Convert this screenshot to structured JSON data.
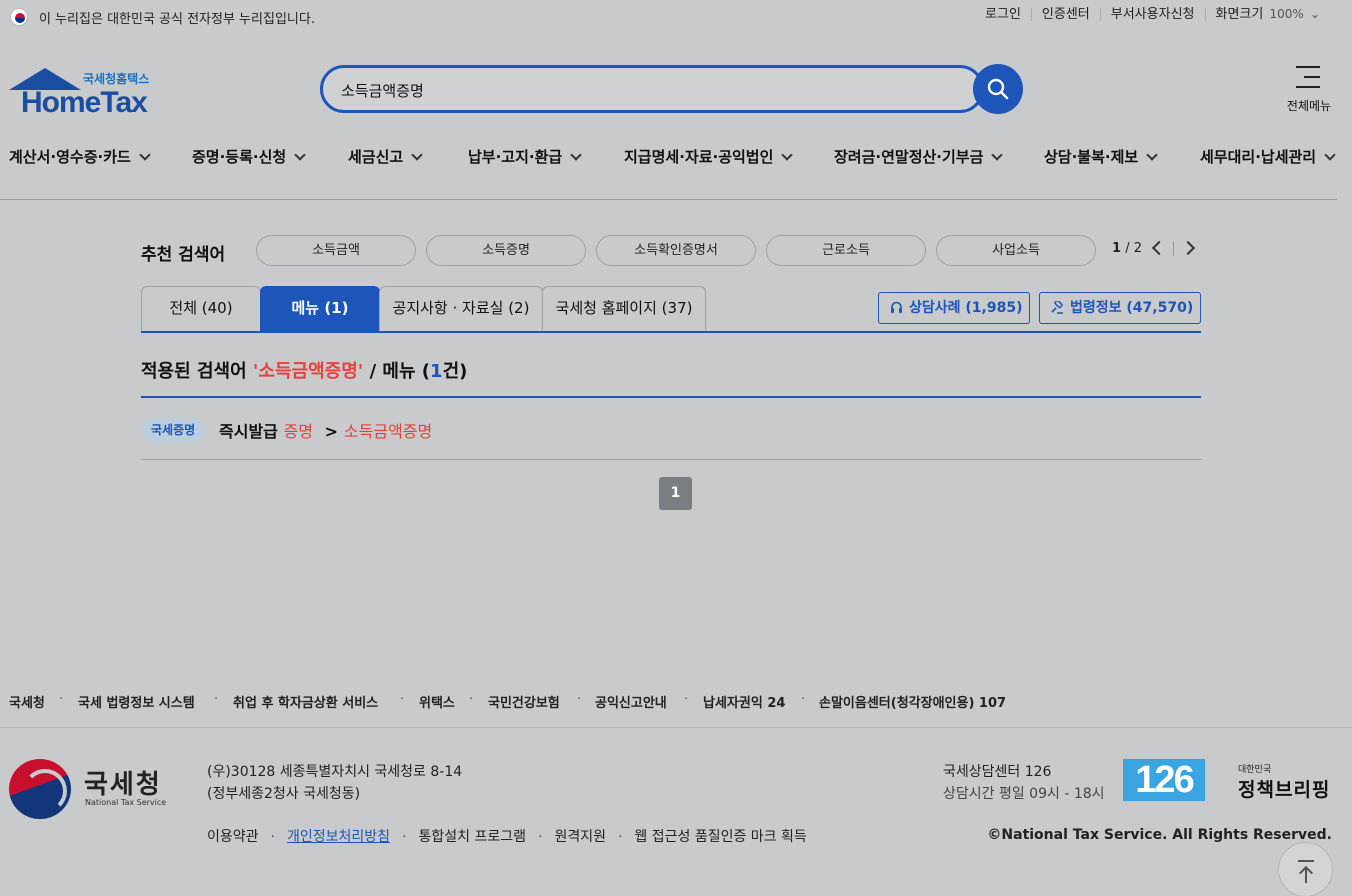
{
  "gov_banner": {
    "text": "이 누리집은 대한민국 공식 전자정부 누리집입니다."
  },
  "utility": {
    "login": "로그인",
    "cert": "인증센터",
    "dept": "부서사용자신청",
    "screen": "화면크기",
    "zoom": "100%"
  },
  "logo": {
    "small": "국세청홈택스",
    "big": "HomeTax"
  },
  "search": {
    "value": "소득금액증명"
  },
  "allmenu": {
    "label": "전체메뉴"
  },
  "gnb": [
    "계산서·영수증·카드",
    "증명·등록·신청",
    "세금신고",
    "납부·고지·환급",
    "지급명세·자료·공익법인",
    "장려금·연말정산·기부금",
    "상담·불복·제보",
    "세무대리·납세관리"
  ],
  "recommend": {
    "title": "추천 검색어",
    "chips": [
      "소득금액",
      "소득증명",
      "소득확인증명서",
      "근로소득",
      "사업소득"
    ],
    "page_current": "1",
    "page_total": "/ 2"
  },
  "tabs": [
    {
      "label": "전체 (40)"
    },
    {
      "label": "메뉴 (1)"
    },
    {
      "label": "공지사항 · 자료실 (2)"
    },
    {
      "label": "국세청 홈페이지 (37)"
    }
  ],
  "side_buttons": {
    "consult": "상담사례 (1,985)",
    "law": "법령정보 (47,570)"
  },
  "applied": {
    "prefix": "적용된 검색어 ",
    "query": "'소득금액증명'",
    "mid": " / 메뉴 (",
    "count": "1",
    "suffix": "건)"
  },
  "result": {
    "badge": "국세증명",
    "crumb1": "즉시발급",
    "crumb2": "증명",
    "sep": ">",
    "crumb3": "소득금액증명"
  },
  "pagination": {
    "current": "1"
  },
  "footer_links": [
    "국세청",
    "국세 법령정보 시스템",
    "취업 후 학자금상환 서비스",
    "위택스",
    "국민건강보험",
    "공익신고안내",
    "납세자권익 24",
    "손말이음센터(청각장애인용) 107"
  ],
  "footer": {
    "nts_ko": "국세청",
    "nts_en": "National Tax Service",
    "addr1": "(우)30128 세종특별자치시 국세청로 8-14",
    "addr2": "(정부세종2청사 국세청동)",
    "policy": [
      "이용약관",
      "개인정보처리방침",
      "통합설치 프로그램",
      "원격지원",
      "웹 접근성 품질인증 마크 획득"
    ],
    "center_name": "국세상담센터 126",
    "center_hours": "상담시간 평일 09시 - 18시",
    "badge_126": "126",
    "briefing_small": "대한민국",
    "briefing_large": "정책브리핑",
    "copyright": "©National Tax Service. All Rights Reserved."
  },
  "colors": {
    "primary": "#1d55b8",
    "accent_red": "#e8403a",
    "overlay_gray": "#c9cacc"
  }
}
